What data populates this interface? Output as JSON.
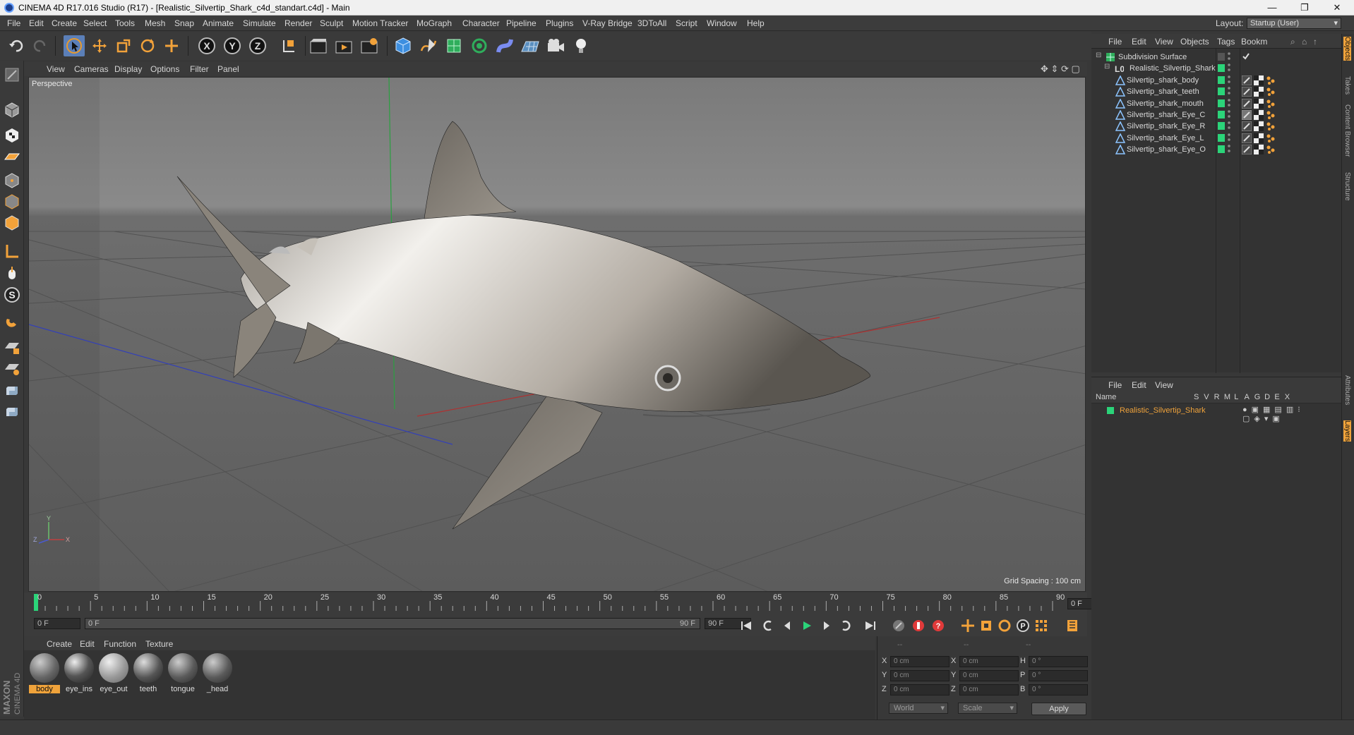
{
  "window": {
    "title": "CINEMA 4D R17.016 Studio (R17) - [Realistic_Silvertip_Shark_c4d_standart.c4d] - Main",
    "controls": [
      "—",
      "❐",
      "✕"
    ]
  },
  "menu": [
    "File",
    "Edit",
    "Create",
    "Select",
    "Tools",
    "Mesh",
    "Snap",
    "Animate",
    "Simulate",
    "Render",
    "Sculpt",
    "Motion Tracker",
    "MoGraph",
    "Character",
    "Pipeline",
    "Plugins",
    "V-Ray Bridge",
    "3DToAll",
    "Script",
    "Window",
    "Help"
  ],
  "layout": {
    "label": "Layout:",
    "value": "Startup (User)"
  },
  "toolbar_icons": [
    "undo-icon",
    "redo-icon",
    "select-arrow-icon",
    "move-icon",
    "scale-icon",
    "rotate-icon",
    "move-add-icon",
    "axis-x-icon",
    "axis-y-icon",
    "axis-z-icon",
    "coordinate-system-icon",
    "render-view-icon",
    "render-picture-viewer-icon",
    "edit-render-settings-icon",
    "cube-icon",
    "pen-spline-icon",
    "subdivision-icon",
    "array-icon",
    "deformer-icon",
    "floor-icon",
    "camera-icon",
    "light-icon"
  ],
  "viewport": {
    "menu": [
      "View",
      "Cameras",
      "Display",
      "Options",
      "Filter",
      "Panel"
    ],
    "label": "Perspective",
    "grid_spacing": "Grid Spacing : 100 cm"
  },
  "timeline": {
    "ticks": [
      "0",
      "5",
      "10",
      "15",
      "20",
      "25",
      "30",
      "35",
      "40",
      "45",
      "50",
      "55",
      "60",
      "65",
      "70",
      "75",
      "80",
      "85",
      "90"
    ],
    "current_frame": "0 F",
    "start_field": "0 F",
    "range_start": "0 F",
    "range_end": "90 F",
    "end_field": "90 F"
  },
  "materials": {
    "menu": [
      "Create",
      "Edit",
      "Function",
      "Texture"
    ],
    "items": [
      "body",
      "eye_ins",
      "eye_out",
      "teeth",
      "tongue",
      "_head"
    ]
  },
  "coords": {
    "header": [
      "--",
      "--",
      "--"
    ],
    "rows": [
      {
        "a": "X",
        "av": "0 cm",
        "b": "X",
        "bv": "0 cm",
        "c": "H",
        "cv": "0 °"
      },
      {
        "a": "Y",
        "av": "0 cm",
        "b": "Y",
        "bv": "0 cm",
        "c": "P",
        "cv": "0 °"
      },
      {
        "a": "Z",
        "av": "0 cm",
        "b": "Z",
        "bv": "0 cm",
        "c": "B",
        "cv": "0 °"
      }
    ],
    "mode1": "World",
    "mode2": "Scale",
    "apply": "Apply"
  },
  "objects": {
    "menu": [
      "File",
      "Edit",
      "View",
      "Objects",
      "Tags",
      "Bookm"
    ],
    "items": [
      {
        "name": "Subdivision Surface",
        "level": 0
      },
      {
        "name": "Realistic_Silvertip_Shark",
        "level": 1
      },
      {
        "name": "Silvertip_shark_body",
        "level": 2
      },
      {
        "name": "Silvertip_shark_teeth",
        "level": 2
      },
      {
        "name": "Silvertip_shark_mouth",
        "level": 2
      },
      {
        "name": "Silvertip_shark_Eye_C",
        "level": 2
      },
      {
        "name": "Silvertip_shark_Eye_R",
        "level": 2
      },
      {
        "name": "Silvertip_shark_Eye_L",
        "level": 2
      },
      {
        "name": "Silvertip_shark_Eye_O",
        "level": 2
      }
    ]
  },
  "layers": {
    "menu": [
      "File",
      "Edit",
      "View"
    ],
    "header": {
      "name": "Name",
      "cols": [
        "S",
        "V",
        "R",
        "M",
        "L",
        "A",
        "G",
        "D",
        "E",
        "X"
      ]
    },
    "items": [
      "Realistic_Silvertip_Shark"
    ]
  },
  "right_tabs": [
    "Objects",
    "Takes",
    "Content Browser",
    "Structure",
    "Attributes",
    "Layers"
  ],
  "logo": {
    "line1": "MAXON",
    "line2": "CINEMA 4D"
  },
  "colors": {
    "accent": "#f0a33b",
    "active_blue": "#5b7fb8",
    "layer_green": "#2bd479"
  }
}
